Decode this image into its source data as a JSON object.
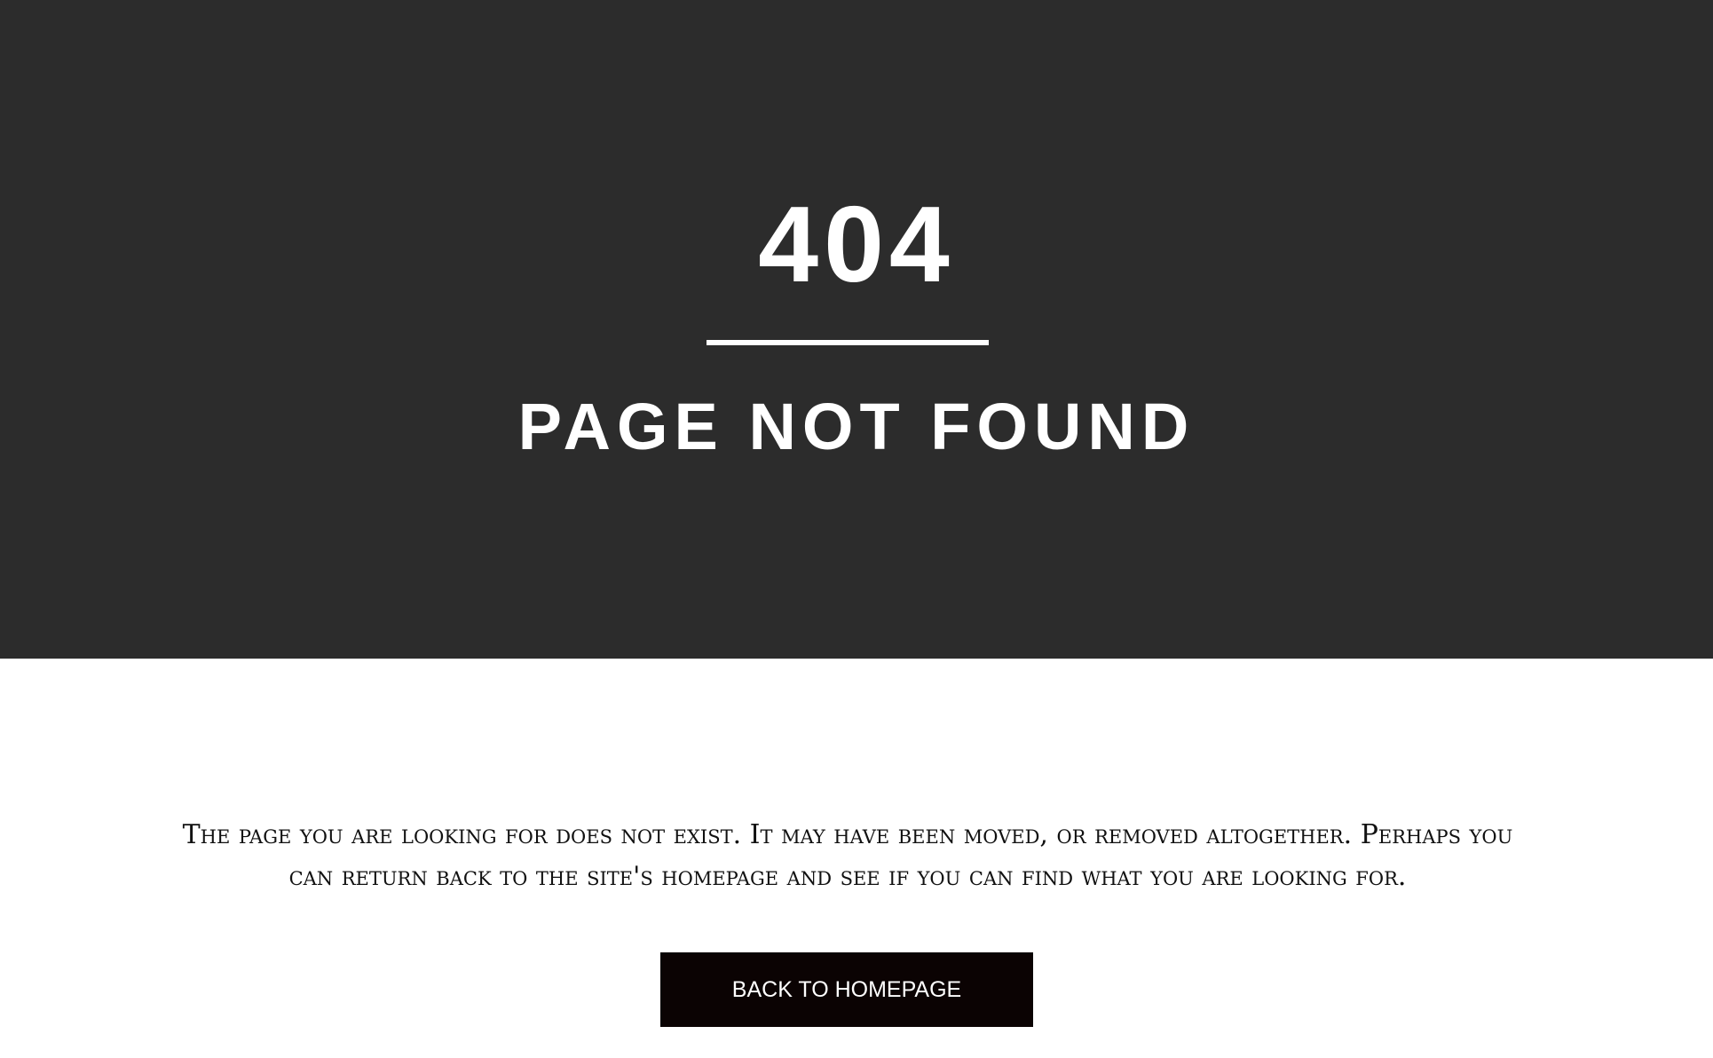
{
  "hero": {
    "error_code": "404",
    "title": "PAGE NOT FOUND"
  },
  "content": {
    "message": "The page you are looking for does not exist. It may have been moved, or removed altogether. Perhaps you can return back to the site's homepage and see if you can find what you are looking for.",
    "button_label": "BACK TO HOMEPAGE"
  },
  "colors": {
    "hero_background": "#2c2c2c",
    "page_background": "#ffffff",
    "button_background": "#0b0303",
    "hero_text": "#ffffff"
  }
}
